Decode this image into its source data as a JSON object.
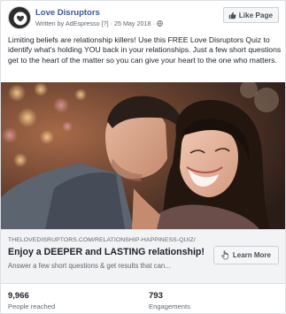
{
  "post": {
    "page_name": "Love Disruptors",
    "byline": "Written by AdEspresso [?] · 25 May 2018 ·",
    "like_page_label": "Like Page",
    "body_text": "Limiting beliefs are relationship killers! Use this FREE Love Disruptors Quiz to identify what's holding YOU back in your relationships. Just a few short questions get to the heart of the matter so you can give your heart to the one who matters."
  },
  "link": {
    "domain": "THELOVEDISRUPTORS.COM/RELATIONSHIP-HAPPINESS-QUIZ/",
    "headline": "Enjoy a DEEPER and LASTING relationship!",
    "description": "Answer a few short questions & get results that can...",
    "cta_label": "Learn More"
  },
  "stats": {
    "reach_value": "9,966",
    "reach_label": "People reached",
    "engagement_value": "793",
    "engagement_label": "Engagements"
  },
  "icons": {
    "avatar": "love-disruptors-logo",
    "privacy": "globe-icon",
    "like": "thumbs-up-icon",
    "cta": "cursor-icon"
  },
  "colors": {
    "page_name": "#385898",
    "text": "#1d2129",
    "muted": "#606770",
    "link_box_bg": "#f2f3f5"
  }
}
